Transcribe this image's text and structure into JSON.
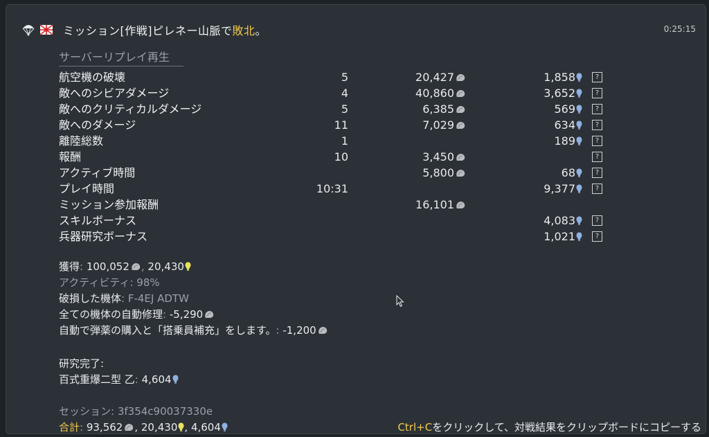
{
  "header": {
    "title_main": "ミッション[作戦]ピレネー山脈で",
    "title_result": "敗北",
    "title_tail": "。",
    "time": "0:25:15",
    "icons": [
      "parachute-icon",
      "rising-sun-flag-icon"
    ]
  },
  "replay_label": "サーバーリプレイ再生",
  "rows": [
    {
      "label": "航空機の破壊",
      "count": "5",
      "sl": "20,427",
      "rp": "1,858",
      "help": "?"
    },
    {
      "label": "敵へのシビアダメージ",
      "count": "4",
      "sl": "40,860",
      "rp": "3,652",
      "help": "?"
    },
    {
      "label": "敵へのクリティカルダメージ",
      "count": "5",
      "sl": "6,385",
      "rp": "569",
      "help": "?"
    },
    {
      "label": "敵へのダメージ",
      "count": "11",
      "sl": "7,029",
      "rp": "634",
      "help": "?"
    },
    {
      "label": "離陸総数",
      "count": "1",
      "sl": "",
      "rp": "189",
      "help": "?"
    },
    {
      "label": "報酬",
      "count": "10",
      "sl": "3,450",
      "rp": "",
      "help": "?"
    },
    {
      "label": "アクティブ時間",
      "count": "",
      "sl": "5,800",
      "rp": "68",
      "help": "?"
    },
    {
      "label": "プレイ時間",
      "count": "10:31",
      "sl": "",
      "rp": "9,377",
      "help": "?"
    },
    {
      "label": "ミッション参加報酬",
      "count": "",
      "sl": "16,101",
      "rp": "",
      "help": ""
    },
    {
      "label": "スキルボーナス",
      "count": "",
      "sl": "",
      "rp": "4,083",
      "help": "?"
    },
    {
      "label": "兵器研究ボーナス",
      "count": "",
      "sl": "",
      "rp": "1,021",
      "help": "?"
    }
  ],
  "summary": {
    "earned_label": "獲得",
    "earned_sl": "100,052",
    "earned_rp": "20,430",
    "activity_label": "アクティビティ",
    "activity_value": "98%",
    "damaged_label": "破損した機体",
    "damaged_value": "F-4EJ ADTW",
    "repair_label": "全ての機体の自動修理",
    "repair_value": "-5,290",
    "ammo_label": "自動で弾薬の購入と「搭乗員補充」をします。",
    "ammo_value": "-1,200"
  },
  "research": {
    "title": "研究完了:",
    "item_label": "百式重爆二型 乙",
    "item_value": "4,604"
  },
  "session": {
    "label": "セッション",
    "value": "3f354c90037330e"
  },
  "total": {
    "label": "合計",
    "sl": "93,562",
    "rp_free": "20,430",
    "rp": "4,604"
  },
  "copy_hint": {
    "key": "Ctrl+C",
    "text": "をクリックして、対戦結果をクリップボードにコピーする"
  },
  "colors": {
    "accent": "#f2c94c",
    "rp_blue": "#8fb0e0",
    "free_rp_yellow": "#e8e060",
    "panel": "#2b3136"
  }
}
